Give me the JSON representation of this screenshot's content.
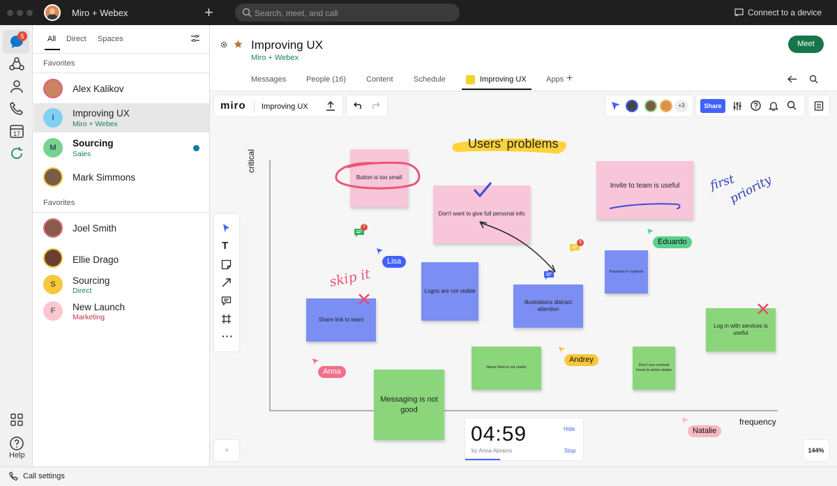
{
  "titlebar": {
    "app_title": "Miro + Webex",
    "search_placeholder": "Search, meet, and call",
    "connect_label": "Connect to a device"
  },
  "rail": {
    "badge_count": "5",
    "help_label": "Help",
    "calendar_day": "17"
  },
  "list": {
    "tabs": [
      "All",
      "Direct",
      "Spaces"
    ],
    "favorites_label": "Favorites",
    "favorites_label_2": "Favorites",
    "rows": [
      {
        "name": "Alex Kalikov",
        "sub": ""
      },
      {
        "name": "Improving UX",
        "sub": "Miro + Webex",
        "initial": "I"
      },
      {
        "name": "Sourcing",
        "sub": "Sales",
        "initial": "M"
      },
      {
        "name": "Mark Simmons",
        "sub": ""
      },
      {
        "name": "Joel Smith",
        "sub": ""
      },
      {
        "name": "Ellie Drago",
        "sub": ""
      },
      {
        "name": "Sourcing",
        "sub": "Direct",
        "initial": "S"
      },
      {
        "name": "New Launch",
        "sub": "Marketing",
        "initial": "F"
      }
    ]
  },
  "header": {
    "title": "Improving UX",
    "subtitle": "Miro + Webex",
    "meet_label": "Meet",
    "tabs": [
      "Messages",
      "People (16)",
      "Content",
      "Schedule",
      "Improving UX",
      "Apps"
    ]
  },
  "board": {
    "logo": "miro",
    "board_name": "Improving UX",
    "share_label": "Share",
    "extra_users": "+3",
    "zoom": "144%",
    "heading": "Users' problems",
    "axis_y": "critical",
    "axis_x": "frequency",
    "handwriting_skip": "skip it",
    "handwriting_first": "first",
    "handwriting_priority": "priority",
    "comment_count_1": "7",
    "comment_count_2": "3",
    "stickies": {
      "button": "Button is too small",
      "personal": "Don't want to give full personal info",
      "invite": "Invite to team is useful",
      "password": "Password 8+ symbols",
      "logos": "Logos are not visible",
      "illustrations": "Illustrations distract attention",
      "share_link": "Share link to team",
      "login": "Log in with services is useful",
      "name_field": "Name field is not useful",
      "controls": "Don't see controls hover & active states",
      "messaging": "Messaging is not good"
    },
    "cursors": {
      "lisa": "Lisa",
      "eduardo": "Eduardo",
      "andrey": "Andrey",
      "anna": "Anna",
      "natalie": "Natalie"
    },
    "timer": {
      "time": "04:59",
      "by": "by Anna Abrams",
      "hide": "Hide",
      "stop": "Stop"
    }
  },
  "bottombar": {
    "call_settings": "Call settings"
  },
  "colors": {
    "accent_green": "#18754a",
    "miro_blue": "#4262ff",
    "badge_red": "#e0493c"
  }
}
